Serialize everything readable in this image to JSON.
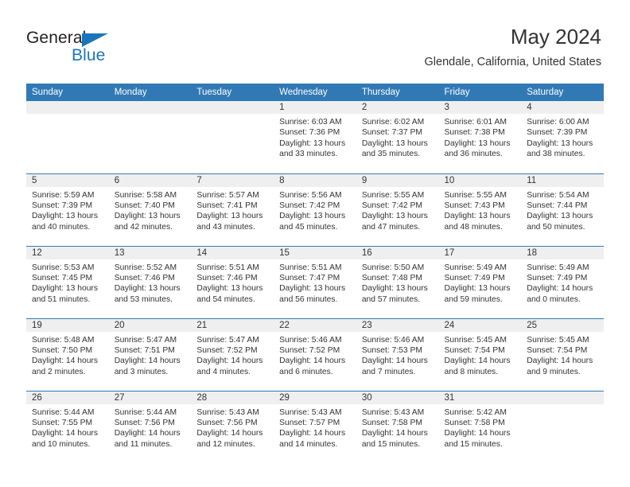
{
  "brand": {
    "name_primary": "General",
    "name_secondary": "Blue",
    "logo_icon": "triangle-logo-icon",
    "accent_color": "#1b75bb"
  },
  "header": {
    "title": "May 2024",
    "subtitle": "Glendale, California, United States"
  },
  "theme": {
    "header_bar_color": "#3179b5",
    "daynum_band_color": "#efefef",
    "text_color": "#333333"
  },
  "weekdays": [
    "Sunday",
    "Monday",
    "Tuesday",
    "Wednesday",
    "Thursday",
    "Friday",
    "Saturday"
  ],
  "weeks": [
    [
      {
        "day": "",
        "sunrise": "",
        "sunset": "",
        "daylight": "",
        "daylight2": ""
      },
      {
        "day": "",
        "sunrise": "",
        "sunset": "",
        "daylight": "",
        "daylight2": ""
      },
      {
        "day": "",
        "sunrise": "",
        "sunset": "",
        "daylight": "",
        "daylight2": ""
      },
      {
        "day": "1",
        "sunrise": "Sunrise: 6:03 AM",
        "sunset": "Sunset: 7:36 PM",
        "daylight": "Daylight: 13 hours",
        "daylight2": "and 33 minutes."
      },
      {
        "day": "2",
        "sunrise": "Sunrise: 6:02 AM",
        "sunset": "Sunset: 7:37 PM",
        "daylight": "Daylight: 13 hours",
        "daylight2": "and 35 minutes."
      },
      {
        "day": "3",
        "sunrise": "Sunrise: 6:01 AM",
        "sunset": "Sunset: 7:38 PM",
        "daylight": "Daylight: 13 hours",
        "daylight2": "and 36 minutes."
      },
      {
        "day": "4",
        "sunrise": "Sunrise: 6:00 AM",
        "sunset": "Sunset: 7:39 PM",
        "daylight": "Daylight: 13 hours",
        "daylight2": "and 38 minutes."
      }
    ],
    [
      {
        "day": "5",
        "sunrise": "Sunrise: 5:59 AM",
        "sunset": "Sunset: 7:39 PM",
        "daylight": "Daylight: 13 hours",
        "daylight2": "and 40 minutes."
      },
      {
        "day": "6",
        "sunrise": "Sunrise: 5:58 AM",
        "sunset": "Sunset: 7:40 PM",
        "daylight": "Daylight: 13 hours",
        "daylight2": "and 42 minutes."
      },
      {
        "day": "7",
        "sunrise": "Sunrise: 5:57 AM",
        "sunset": "Sunset: 7:41 PM",
        "daylight": "Daylight: 13 hours",
        "daylight2": "and 43 minutes."
      },
      {
        "day": "8",
        "sunrise": "Sunrise: 5:56 AM",
        "sunset": "Sunset: 7:42 PM",
        "daylight": "Daylight: 13 hours",
        "daylight2": "and 45 minutes."
      },
      {
        "day": "9",
        "sunrise": "Sunrise: 5:55 AM",
        "sunset": "Sunset: 7:42 PM",
        "daylight": "Daylight: 13 hours",
        "daylight2": "and 47 minutes."
      },
      {
        "day": "10",
        "sunrise": "Sunrise: 5:55 AM",
        "sunset": "Sunset: 7:43 PM",
        "daylight": "Daylight: 13 hours",
        "daylight2": "and 48 minutes."
      },
      {
        "day": "11",
        "sunrise": "Sunrise: 5:54 AM",
        "sunset": "Sunset: 7:44 PM",
        "daylight": "Daylight: 13 hours",
        "daylight2": "and 50 minutes."
      }
    ],
    [
      {
        "day": "12",
        "sunrise": "Sunrise: 5:53 AM",
        "sunset": "Sunset: 7:45 PM",
        "daylight": "Daylight: 13 hours",
        "daylight2": "and 51 minutes."
      },
      {
        "day": "13",
        "sunrise": "Sunrise: 5:52 AM",
        "sunset": "Sunset: 7:46 PM",
        "daylight": "Daylight: 13 hours",
        "daylight2": "and 53 minutes."
      },
      {
        "day": "14",
        "sunrise": "Sunrise: 5:51 AM",
        "sunset": "Sunset: 7:46 PM",
        "daylight": "Daylight: 13 hours",
        "daylight2": "and 54 minutes."
      },
      {
        "day": "15",
        "sunrise": "Sunrise: 5:51 AM",
        "sunset": "Sunset: 7:47 PM",
        "daylight": "Daylight: 13 hours",
        "daylight2": "and 56 minutes."
      },
      {
        "day": "16",
        "sunrise": "Sunrise: 5:50 AM",
        "sunset": "Sunset: 7:48 PM",
        "daylight": "Daylight: 13 hours",
        "daylight2": "and 57 minutes."
      },
      {
        "day": "17",
        "sunrise": "Sunrise: 5:49 AM",
        "sunset": "Sunset: 7:49 PM",
        "daylight": "Daylight: 13 hours",
        "daylight2": "and 59 minutes."
      },
      {
        "day": "18",
        "sunrise": "Sunrise: 5:49 AM",
        "sunset": "Sunset: 7:49 PM",
        "daylight": "Daylight: 14 hours",
        "daylight2": "and 0 minutes."
      }
    ],
    [
      {
        "day": "19",
        "sunrise": "Sunrise: 5:48 AM",
        "sunset": "Sunset: 7:50 PM",
        "daylight": "Daylight: 14 hours",
        "daylight2": "and 2 minutes."
      },
      {
        "day": "20",
        "sunrise": "Sunrise: 5:47 AM",
        "sunset": "Sunset: 7:51 PM",
        "daylight": "Daylight: 14 hours",
        "daylight2": "and 3 minutes."
      },
      {
        "day": "21",
        "sunrise": "Sunrise: 5:47 AM",
        "sunset": "Sunset: 7:52 PM",
        "daylight": "Daylight: 14 hours",
        "daylight2": "and 4 minutes."
      },
      {
        "day": "22",
        "sunrise": "Sunrise: 5:46 AM",
        "sunset": "Sunset: 7:52 PM",
        "daylight": "Daylight: 14 hours",
        "daylight2": "and 6 minutes."
      },
      {
        "day": "23",
        "sunrise": "Sunrise: 5:46 AM",
        "sunset": "Sunset: 7:53 PM",
        "daylight": "Daylight: 14 hours",
        "daylight2": "and 7 minutes."
      },
      {
        "day": "24",
        "sunrise": "Sunrise: 5:45 AM",
        "sunset": "Sunset: 7:54 PM",
        "daylight": "Daylight: 14 hours",
        "daylight2": "and 8 minutes."
      },
      {
        "day": "25",
        "sunrise": "Sunrise: 5:45 AM",
        "sunset": "Sunset: 7:54 PM",
        "daylight": "Daylight: 14 hours",
        "daylight2": "and 9 minutes."
      }
    ],
    [
      {
        "day": "26",
        "sunrise": "Sunrise: 5:44 AM",
        "sunset": "Sunset: 7:55 PM",
        "daylight": "Daylight: 14 hours",
        "daylight2": "and 10 minutes."
      },
      {
        "day": "27",
        "sunrise": "Sunrise: 5:44 AM",
        "sunset": "Sunset: 7:56 PM",
        "daylight": "Daylight: 14 hours",
        "daylight2": "and 11 minutes."
      },
      {
        "day": "28",
        "sunrise": "Sunrise: 5:43 AM",
        "sunset": "Sunset: 7:56 PM",
        "daylight": "Daylight: 14 hours",
        "daylight2": "and 12 minutes."
      },
      {
        "day": "29",
        "sunrise": "Sunrise: 5:43 AM",
        "sunset": "Sunset: 7:57 PM",
        "daylight": "Daylight: 14 hours",
        "daylight2": "and 14 minutes."
      },
      {
        "day": "30",
        "sunrise": "Sunrise: 5:43 AM",
        "sunset": "Sunset: 7:58 PM",
        "daylight": "Daylight: 14 hours",
        "daylight2": "and 15 minutes."
      },
      {
        "day": "31",
        "sunrise": "Sunrise: 5:42 AM",
        "sunset": "Sunset: 7:58 PM",
        "daylight": "Daylight: 14 hours",
        "daylight2": "and 15 minutes."
      },
      {
        "day": "",
        "sunrise": "",
        "sunset": "",
        "daylight": "",
        "daylight2": ""
      }
    ]
  ]
}
